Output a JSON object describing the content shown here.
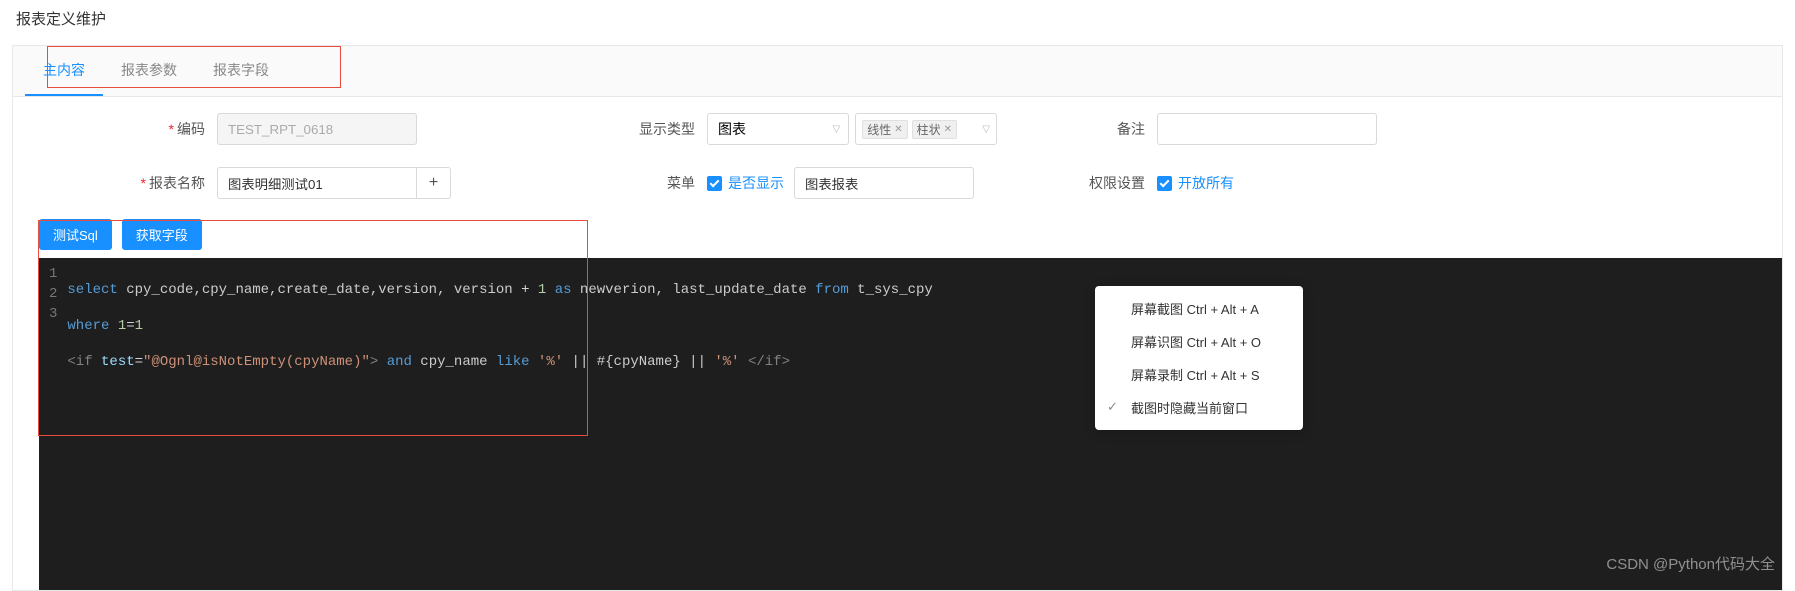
{
  "page_title": "报表定义维护",
  "tabs": [
    "主内容",
    "报表参数",
    "报表字段"
  ],
  "form": {
    "code_label": "编码",
    "code_value": "TEST_RPT_0618",
    "display_type_label": "显示类型",
    "display_type_value": "图表",
    "tag1": "线性",
    "tag2": "柱状",
    "remark_label": "备注",
    "remark_value": "",
    "name_label": "报表名称",
    "name_value": "图表明细测试01",
    "menu_label": "菜单",
    "show_label": "是否显示",
    "menu_input": "图表报表",
    "perm_label": "权限设置",
    "perm_chk_label": "开放所有"
  },
  "buttons": {
    "test_sql": "测试Sql",
    "get_fields": "获取字段"
  },
  "code": {
    "l1a": "select",
    "l1b": " cpy_code,cpy_name,create_date,version, version ",
    "l1c": "+",
    "l1d": " 1 ",
    "l1e": "as",
    "l1f": " newverion, last_update_date ",
    "l1g": "from",
    "l1h": " t_sys_cpy",
    "l2a": "where",
    "l2b": " 1",
    "l2c": "=",
    "l2d": "1",
    "l3a": "<if",
    "l3b": " test",
    "l3c": "=",
    "l3d": "\"@Ognl@isNotEmpty(cpyName)\"",
    "l3e": ">",
    "l3f": " and",
    "l3g": " cpy_name ",
    "l3h": "like",
    "l3i": " '%'",
    "l3j": " || #{cpyName} || ",
    "l3k": "'%'",
    "l3l": " </if>"
  },
  "context_menu": {
    "item1": "屏幕截图 Ctrl + Alt + A",
    "item2": "屏幕识图 Ctrl + Alt + O",
    "item3": "屏幕录制 Ctrl + Alt + S",
    "item4": "截图时隐藏当前窗口"
  },
  "watermark": "CSDN @Python代码大全"
}
